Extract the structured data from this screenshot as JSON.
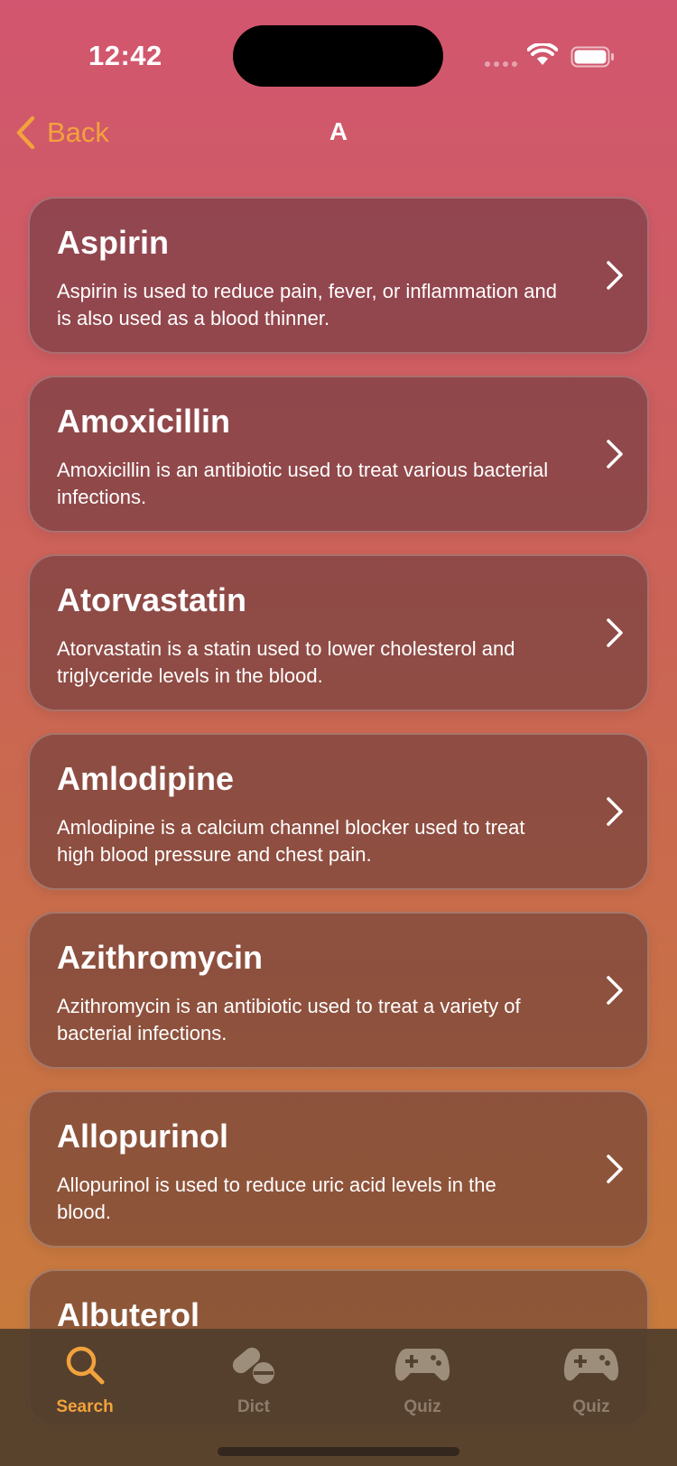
{
  "status_bar": {
    "time": "12:42"
  },
  "nav": {
    "back_label": "Back",
    "title": "A"
  },
  "drugs": [
    {
      "name": "Aspirin",
      "description": "Aspirin is used to reduce pain, fever, or inflammation and is also used as a blood thinner."
    },
    {
      "name": "Amoxicillin",
      "description": "Amoxicillin is an antibiotic used to treat various bacterial infections."
    },
    {
      "name": "Atorvastatin",
      "description": "Atorvastatin is a statin used to lower cholesterol and triglyceride levels in the blood."
    },
    {
      "name": "Amlodipine",
      "description": "Amlodipine is a calcium channel blocker used to treat high blood pressure and chest pain."
    },
    {
      "name": "Azithromycin",
      "description": "Azithromycin is an antibiotic used to treat a variety of bacterial infections."
    },
    {
      "name": "Allopurinol",
      "description": "Allopurinol is used to reduce uric acid levels in the blood."
    },
    {
      "name": "Albuterol",
      "description": ""
    }
  ],
  "tabs": [
    {
      "label": "Search",
      "icon": "search-icon",
      "active": true
    },
    {
      "label": "Dict",
      "icon": "pill-icon",
      "active": false
    },
    {
      "label": "Quiz",
      "icon": "gamepad-icon",
      "active": false
    },
    {
      "label": "Quiz",
      "icon": "gamepad-icon",
      "active": false
    }
  ],
  "colors": {
    "accent": "#f2a23d",
    "inactive_tab": "#b5a796"
  }
}
